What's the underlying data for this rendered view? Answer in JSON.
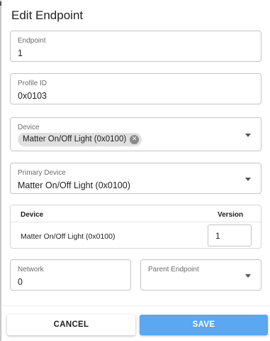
{
  "dialog": {
    "title": "Edit Endpoint"
  },
  "fields": {
    "endpoint": {
      "label": "Endpoint",
      "value": "1"
    },
    "profile_id": {
      "label": "Profile ID",
      "value": "0x0103"
    },
    "device": {
      "label": "Device",
      "chip": "Matter On/Off Light (0x0100)"
    },
    "primary_device": {
      "label": "Primary Device",
      "value": "Matter On/Off Light (0x0100)"
    },
    "network": {
      "label": "Network",
      "value": "0"
    },
    "parent_endpoint": {
      "label": "Parent Endpoint",
      "value": ""
    }
  },
  "table": {
    "columns": [
      "Device",
      "Version"
    ],
    "rows": [
      {
        "device": "Matter On/Off Light (0x0100)",
        "version": "1"
      }
    ]
  },
  "buttons": {
    "cancel": "CANCEL",
    "save": "SAVE"
  },
  "colors": {
    "save_button": "#5aa7f2",
    "chip_background": "#e0e0e0"
  },
  "icons": {
    "chip_remove": "cancel-icon",
    "dropdown": "caret-down-icon"
  }
}
